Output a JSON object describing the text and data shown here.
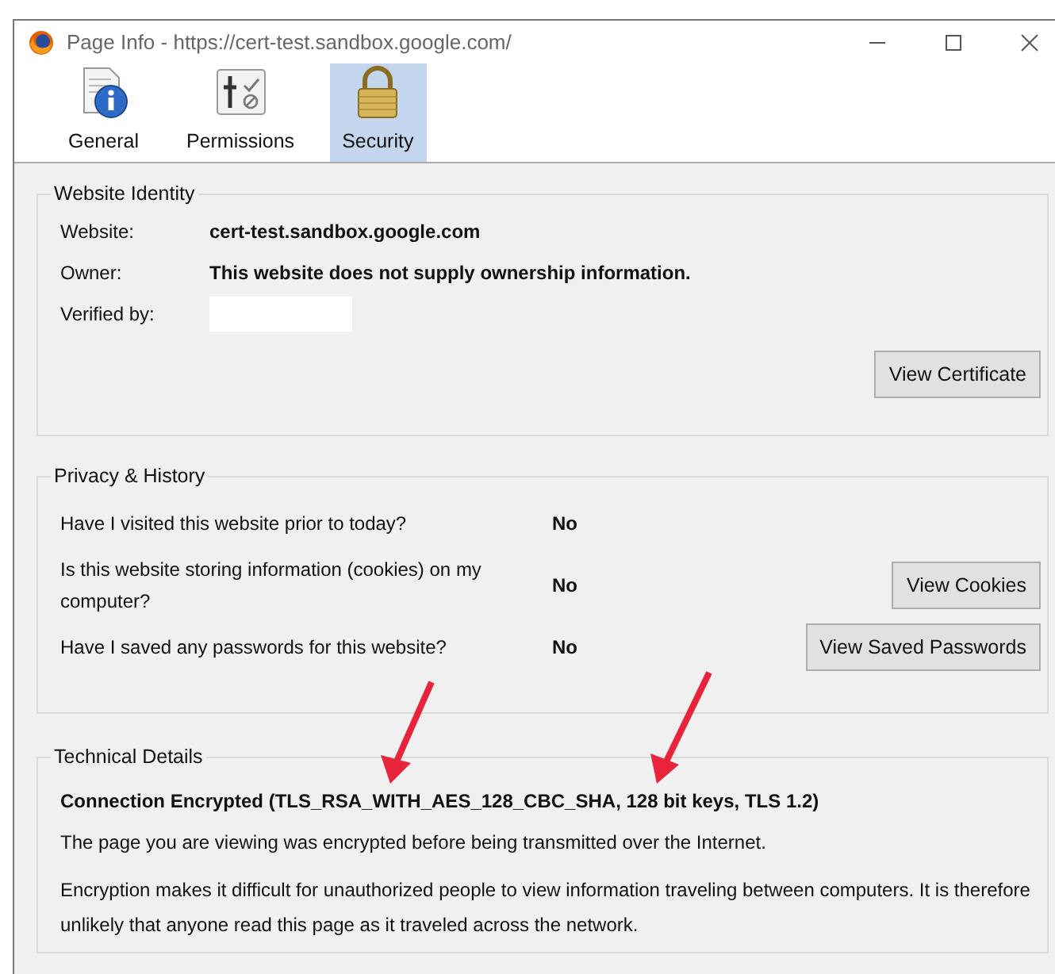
{
  "window": {
    "title": "Page Info - https://cert-test.sandbox.google.com/"
  },
  "tabs": [
    {
      "label": "General",
      "kind": "info",
      "selected": false
    },
    {
      "label": "Permissions",
      "kind": "permissions",
      "selected": false
    },
    {
      "label": "Security",
      "kind": "lock",
      "selected": true
    }
  ],
  "website_identity": {
    "title": "Website Identity",
    "fields": [
      {
        "label": "Website:",
        "value": "cert-test.sandbox.google.com"
      },
      {
        "label": "Owner:",
        "value": "This website does not supply ownership information."
      },
      {
        "label": "Verified by:",
        "kind": "field"
      }
    ],
    "button": "View Certificate"
  },
  "privacy_history": {
    "title": "Privacy & History",
    "rows": [
      {
        "question": "Have I visited this website prior to today?",
        "answer": "No"
      },
      {
        "question": "Is this website storing information (cookies) on my computer?",
        "answer": "No",
        "button": "View Cookies"
      },
      {
        "question": "Have I saved any passwords for this website?",
        "answer": "No",
        "button": "View Saved Passwords"
      }
    ]
  },
  "technical_details": {
    "title": "Technical Details",
    "heading": "Connection Encrypted (TLS_RSA_WITH_AES_128_CBC_SHA, 128 bit keys, TLS 1.2)",
    "paragraphs": [
      "The page you are viewing was encrypted before being transmitted over the Internet.",
      "Encryption makes it difficult for unauthorized people to view information traveling between computers. It is therefore unlikely that anyone read this page as it traveled across the network."
    ]
  }
}
